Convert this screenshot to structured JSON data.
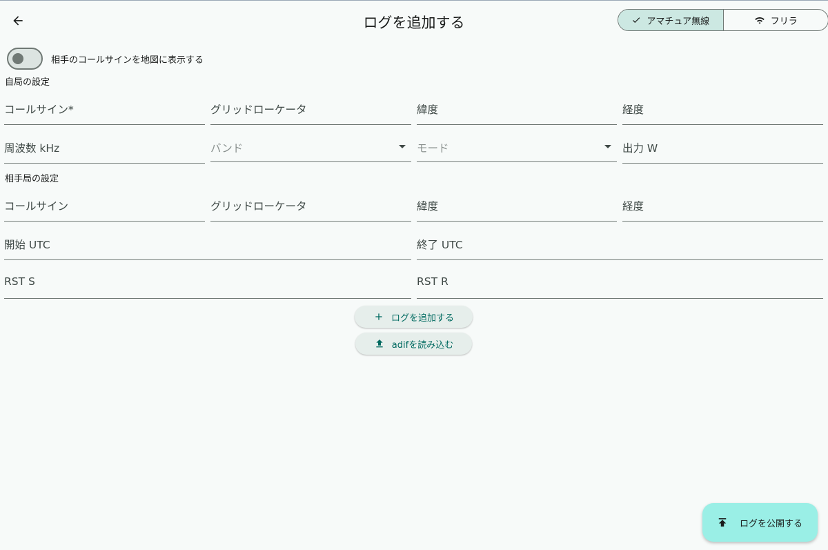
{
  "header": {
    "title": "ログを追加する",
    "back_icon": "arrow-back-icon"
  },
  "mode_toggle": {
    "options": [
      {
        "label": "アマチュア無線",
        "icon": "check-icon",
        "selected": true
      },
      {
        "label": "フリラ",
        "icon": "wifi-icon",
        "selected": false
      }
    ]
  },
  "map_switch": {
    "label": "相手のコールサインを地図に表示する",
    "on": false
  },
  "own_station": {
    "section_label": "自局の設定",
    "callsign": "コールサイン*",
    "grid_locator": "グリッドローケータ",
    "latitude": "緯度",
    "longitude": "経度",
    "frequency": "周波数 kHz",
    "band": "バンド",
    "mode": "モード",
    "power": "出力 W"
  },
  "other_station": {
    "section_label": "相手局の設定",
    "callsign": "コールサイン",
    "grid_locator": "グリッドローケータ",
    "latitude": "緯度",
    "longitude": "経度",
    "start_utc": "開始 UTC",
    "end_utc": "終了 UTC",
    "rst_s": "RST S",
    "rst_r": "RST R"
  },
  "actions": {
    "add_log": "ログを追加する",
    "import_adif": "adifを読み込む"
  },
  "fab": {
    "label": "ログを公開する",
    "icon": "publish-icon"
  },
  "colors": {
    "background": "#f7faf9",
    "selected_segment": "#cce8e2",
    "accent": "#006a60",
    "fab": "#9aefe6"
  }
}
